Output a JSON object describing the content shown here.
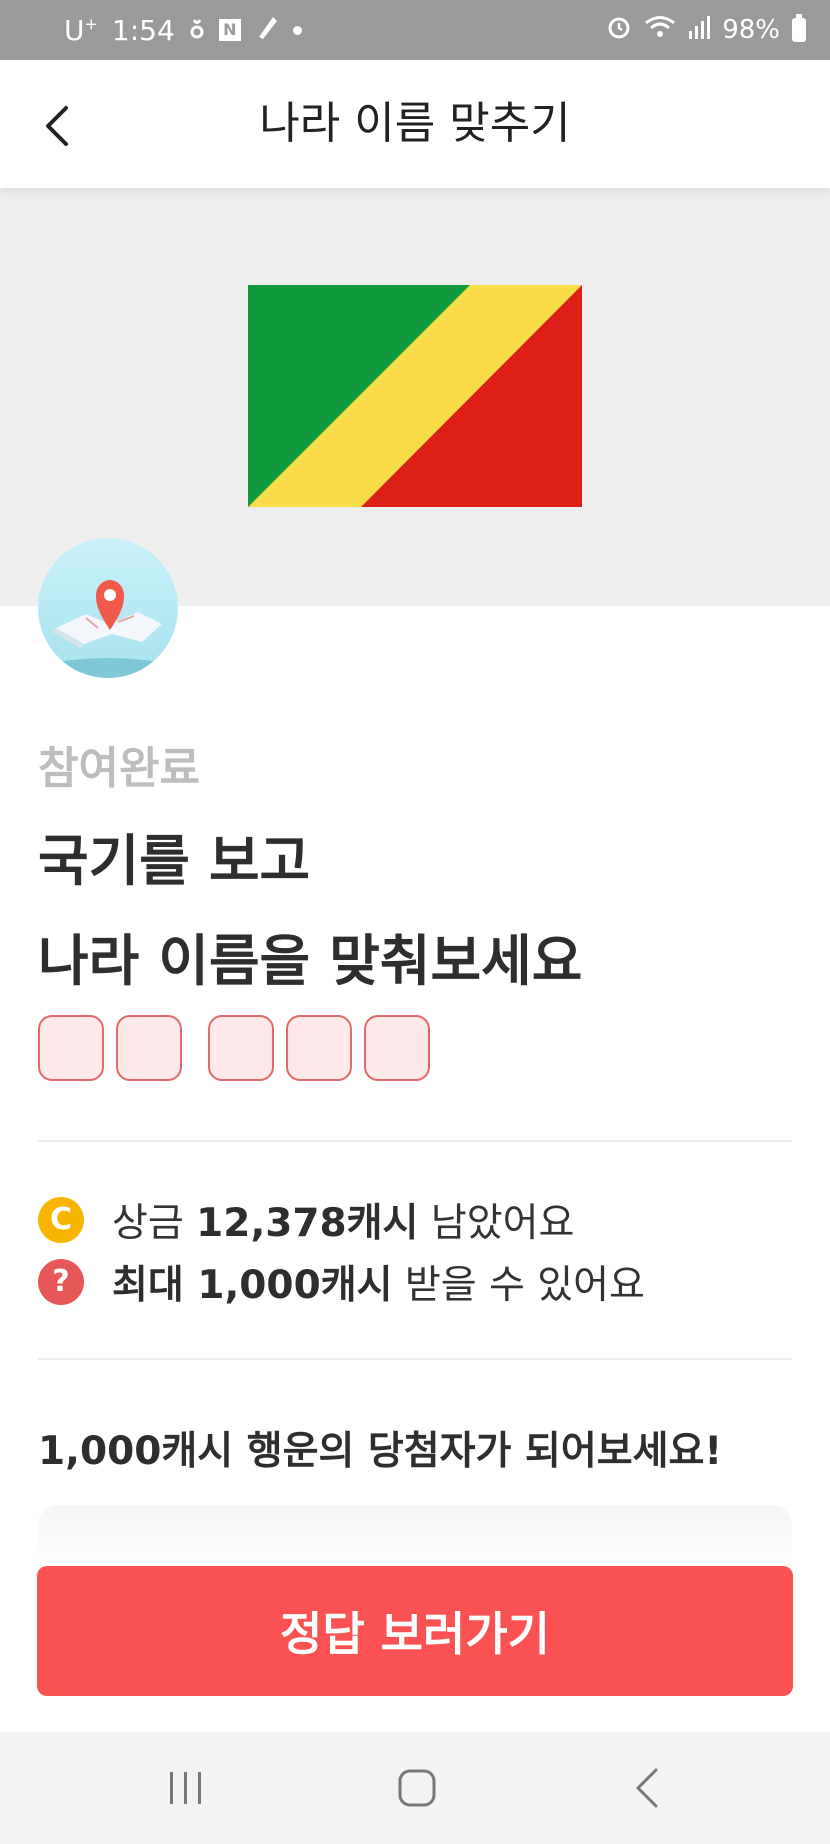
{
  "status_bar": {
    "carrier": "U",
    "carrier_sup": "+",
    "time": "1:54",
    "notif_icons": [
      "thread-icon",
      "naver-icon",
      "pen-icon",
      "dot-icon"
    ],
    "status_icons": [
      "alarm-icon",
      "wifi-icon",
      "signal-icon"
    ],
    "battery": "98%"
  },
  "header": {
    "title": "나라 이름 맞추기"
  },
  "quiz": {
    "flag_colors": {
      "green": "#109a3e",
      "yellow": "#f9dc47",
      "red": "#dd1f1a"
    },
    "status": "참여완료",
    "title_line1": "국기를 보고",
    "title_line2": "나라 이름을 맞춰보세요",
    "answer_groups": [
      2,
      3
    ]
  },
  "prize": {
    "coin_glyph": "C",
    "prefix": "상금 ",
    "amount": "12,378캐시",
    "suffix": " 남았어요"
  },
  "max_reward": {
    "help_glyph": "?",
    "prefix": "최대 ",
    "amount": "1,000캐시",
    "suffix": " 받을 수 있어요"
  },
  "lucky": {
    "text": "1,000캐시 행운의 당첨자가 되어보세요!"
  },
  "cta": {
    "label": "정답 보러가기"
  },
  "colors": {
    "accent": "#fa5252",
    "status_bar": "#9a9a9a",
    "answer_fill": "#fde8ea",
    "answer_border": "#e26a6a"
  }
}
